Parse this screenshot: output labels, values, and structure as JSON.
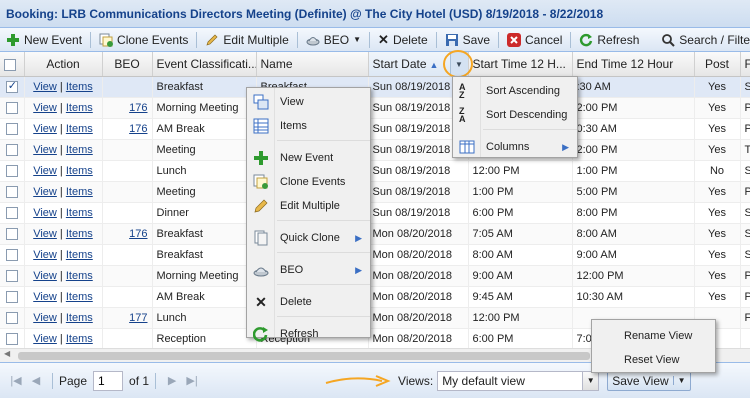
{
  "window": {
    "title": "Booking: LRB Communications Directors Meeting (Definite) @ The City Hotel (USD) 8/19/2018 - 8/22/2018"
  },
  "toolbar": {
    "new_event": "New Event",
    "clone_events": "Clone Events",
    "edit_multiple": "Edit Multiple",
    "beo": "BEO",
    "delete": "Delete",
    "save": "Save",
    "cancel": "Cancel",
    "refresh": "Refresh",
    "search": "Search / Filte"
  },
  "grid": {
    "headers": {
      "action": "Action",
      "beo": "BEO",
      "event_class": "Event Classificati...",
      "name": "Name",
      "start_date": "Start Date",
      "start_time": "Start Time 12 H...",
      "end_time": "End Time 12 Hour",
      "post": "Post",
      "extra": "Fu"
    },
    "rows": [
      {
        "view": "View",
        "items": "Items",
        "beo": "",
        "event": "Breakfast",
        "name": "Breakfast",
        "date": "Sun 08/19/2018",
        "start": "",
        "end": ":30 AM",
        "post": "Yes",
        "extra": "Sa",
        "selected": true
      },
      {
        "view": "View",
        "items": "Items",
        "beo": "176",
        "event": "Morning Meeting",
        "name": "",
        "date": "Sun 08/19/2018",
        "start": "",
        "end": "2:00 PM",
        "post": "Yes",
        "extra": "Pi"
      },
      {
        "view": "View",
        "items": "Items",
        "beo": "176",
        "event": "AM Break",
        "name": "",
        "date": "Sun 08/19/2018",
        "start": "",
        "end": "0:30 AM",
        "post": "Yes",
        "extra": "Pi"
      },
      {
        "view": "View",
        "items": "Items",
        "beo": "",
        "event": "Meeting",
        "name": "",
        "date": "Sun 08/19/2018",
        "start": "",
        "end": "2:00 PM",
        "post": "Yes",
        "extra": "Te"
      },
      {
        "view": "View",
        "items": "Items",
        "beo": "",
        "event": "Lunch",
        "name": "",
        "date": "Sun 08/19/2018",
        "start": "12:00 PM",
        "end": "1:00 PM",
        "post": "No",
        "extra": "Sa"
      },
      {
        "view": "View",
        "items": "Items",
        "beo": "",
        "event": "Meeting",
        "name": "",
        "date": "Sun 08/19/2018",
        "start": "1:00 PM",
        "end": "5:00 PM",
        "post": "Yes",
        "extra": "Pi"
      },
      {
        "view": "View",
        "items": "Items",
        "beo": "",
        "event": "Dinner",
        "name": "",
        "date": "Sun 08/19/2018",
        "start": "6:00 PM",
        "end": "8:00 PM",
        "post": "Yes",
        "extra": "Sa"
      },
      {
        "view": "View",
        "items": "Items",
        "beo": "176",
        "event": "Breakfast",
        "name": "",
        "date": "Mon 08/20/2018",
        "start": "7:05 AM",
        "end": "8:00 AM",
        "post": "Yes",
        "extra": "Sa"
      },
      {
        "view": "View",
        "items": "Items",
        "beo": "",
        "event": "Breakfast",
        "name": "",
        "date": "Mon 08/20/2018",
        "start": "8:00 AM",
        "end": "9:00 AM",
        "post": "Yes",
        "extra": "Sa"
      },
      {
        "view": "View",
        "items": "Items",
        "beo": "",
        "event": "Morning Meeting",
        "name": "",
        "date": "Mon 08/20/2018",
        "start": "9:00 AM",
        "end": "12:00 PM",
        "post": "Yes",
        "extra": "Pi"
      },
      {
        "view": "View",
        "items": "Items",
        "beo": "",
        "event": "AM Break",
        "name": "",
        "date": "Mon 08/20/2018",
        "start": "9:45 AM",
        "end": "10:30 AM",
        "post": "Yes",
        "extra": "Pi"
      },
      {
        "view": "View",
        "items": "Items",
        "beo": "177",
        "event": "Lunch",
        "name": "",
        "date": "Mon 08/20/2018",
        "start": "12:00 PM",
        "end": "",
        "post": "",
        "extra": "Fi"
      },
      {
        "view": "View",
        "items": "Items",
        "beo": "",
        "event": "Reception",
        "name": "Reception",
        "date": "Mon 08/20/2018",
        "start": "6:00 PM",
        "end": "7:0",
        "post": "",
        "extra": ""
      }
    ]
  },
  "context_menu": {
    "items": [
      "View",
      "Items",
      "New Event",
      "Clone Events",
      "Edit Multiple",
      "Quick Clone",
      "BEO",
      "Delete",
      "Refresh"
    ]
  },
  "column_menu": {
    "sort_asc": "Sort Ascending",
    "sort_desc": "Sort Descending",
    "columns": "Columns"
  },
  "view_menu": {
    "rename": "Rename View",
    "reset": "Reset View"
  },
  "pager": {
    "page_label": "Page",
    "page_value": "1",
    "of_label": "of 1",
    "views_label": "Views:",
    "current_view": "My default view",
    "save_view": "Save View"
  },
  "colors": {
    "header_text": "#15428b",
    "accent": "#99bbe8",
    "highlight": "#f5a623"
  }
}
